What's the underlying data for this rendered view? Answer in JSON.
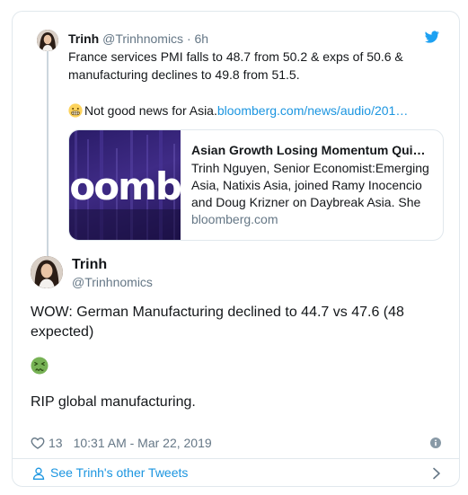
{
  "parent_tweet": {
    "name": "Trinh",
    "handle": "@Trinhnomics",
    "separator": "·",
    "time": "6h",
    "text_line1": "France services PMI falls to 48.7 from 50.2 & exps of 50.6 &",
    "text_line2": "manufacturing declines to 49.8 from 51.5.",
    "text_line3_prefix": "Not good news for Asia.",
    "text_line3_link": "bloomberg.com/news/audio/201…",
    "emoji_icon": "grimacing-face-emoji"
  },
  "link_card": {
    "image_text": "loomber",
    "title": "Asian Growth Losing Momentum Qui…",
    "description": "Trinh Nguyen, Senior Economist:Emerging Asia, Natixis Asia, joined Ramy Inocencio and Doug Krizner on Daybreak Asia. She",
    "domain": "bloomberg.com"
  },
  "main_tweet": {
    "name": "Trinh",
    "handle": "@Trinhnomics",
    "text_para1": "WOW: German Manufacturing declined to 44.7 vs 47.6 (48 expected)",
    "emoji_icon": "nauseated-face-emoji",
    "text_para2": "RIP global manufacturing.",
    "like_count": "13",
    "timestamp": "10:31 AM - Mar 22, 2019"
  },
  "footer": {
    "label": "See Trinh's other Tweets"
  },
  "colors": {
    "link": "#1b95e0",
    "muted": "#657786",
    "border": "#e1e8ed",
    "twitter_blue": "#1da1f2"
  }
}
